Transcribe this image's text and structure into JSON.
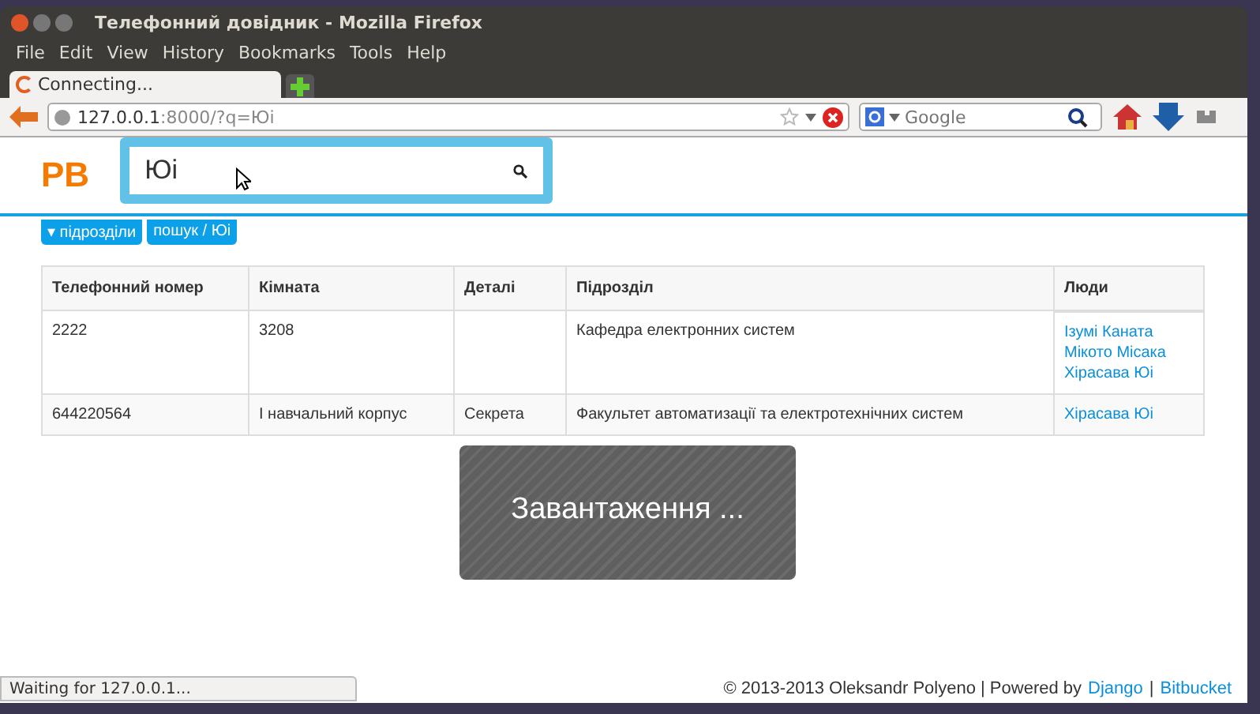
{
  "window": {
    "title": "Телефонний довідник - Mozilla Firefox"
  },
  "menu": [
    "File",
    "Edit",
    "View",
    "History",
    "Bookmarks",
    "Tools",
    "Help"
  ],
  "tab": {
    "label": "Connecting...",
    "selected": true
  },
  "address": {
    "host": "127.0.0.1",
    "rest": ":8000/?q=Юі"
  },
  "web_search": {
    "placeholder": "Google"
  },
  "page": {
    "logo": "PB",
    "search": {
      "value": "Юі"
    },
    "breadcrumbs": [
      "▾ підрозділи",
      "пошук / Юі"
    ],
    "table": {
      "columns": [
        "Телефонний номер",
        "Кімната",
        "Деталі",
        "Підрозділ",
        "Люди"
      ],
      "rows": [
        {
          "phone": "2222",
          "room": "3208",
          "details": "",
          "division": "Кафедра електронних систем",
          "people": [
            "Ізумі Каната",
            "Мікото Місака",
            "Хірасава Юі"
          ]
        },
        {
          "phone": "644220564",
          "room": "І навчальний корпус",
          "details": "Секрета",
          "division": "Факультет автоматизації та електротехнічних систем",
          "people": [
            "Хірасава Юі"
          ]
        }
      ]
    },
    "loading": "Завантаження ...",
    "footer": {
      "text": "© 2013-2013 Oleksandr Polyeno | Powered by",
      "links": [
        "Django",
        "Bitbucket"
      ],
      "separator": "|"
    }
  },
  "status_bar": "Waiting for 127.0.0.1..."
}
